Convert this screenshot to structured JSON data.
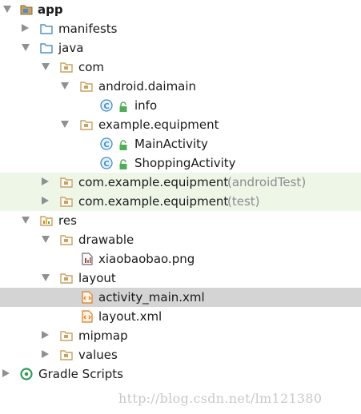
{
  "tree": {
    "app": {
      "label": "app"
    },
    "manifests": {
      "label": "manifests"
    },
    "java": {
      "label": "java"
    },
    "com": {
      "label": "com"
    },
    "android_daimain": {
      "label": "android.daimain"
    },
    "info": {
      "label": "info",
      "icon": "class-c-icon"
    },
    "example_equipment": {
      "label": "example.equipment"
    },
    "main_activity": {
      "label": "MainActivity",
      "icon": "class-c-icon"
    },
    "shopping_activity": {
      "label": "ShoppingActivity",
      "icon": "class-c-icon"
    },
    "android_test_pkg": {
      "label": "com.example.equipment",
      "suffix": "(androidTest)"
    },
    "test_pkg": {
      "label": "com.example.equipment",
      "suffix": "(test)"
    },
    "res": {
      "label": "res"
    },
    "drawable": {
      "label": "drawable"
    },
    "xiaobaobao": {
      "label": "xiaobaobao.png"
    },
    "layout": {
      "label": "layout"
    },
    "activity_main": {
      "label": "activity_main.xml"
    },
    "layout_xml": {
      "label": "layout.xml"
    },
    "mipmap": {
      "label": "mipmap"
    },
    "values": {
      "label": "values"
    },
    "gradle_scripts": {
      "label": "Gradle Scripts"
    }
  },
  "watermark": "http://blog.csdn.net/lm121380",
  "colors": {
    "selected_row": "#d4d4d4",
    "test_row": "#eef6e8",
    "folder": "#d6a85a",
    "java_folder": "#4a90c8",
    "class_icon": "#3d8fd6",
    "lock": "#4caf50",
    "xml_icon": "#e07b1b",
    "gradle_icon": "#2e9e5b"
  }
}
